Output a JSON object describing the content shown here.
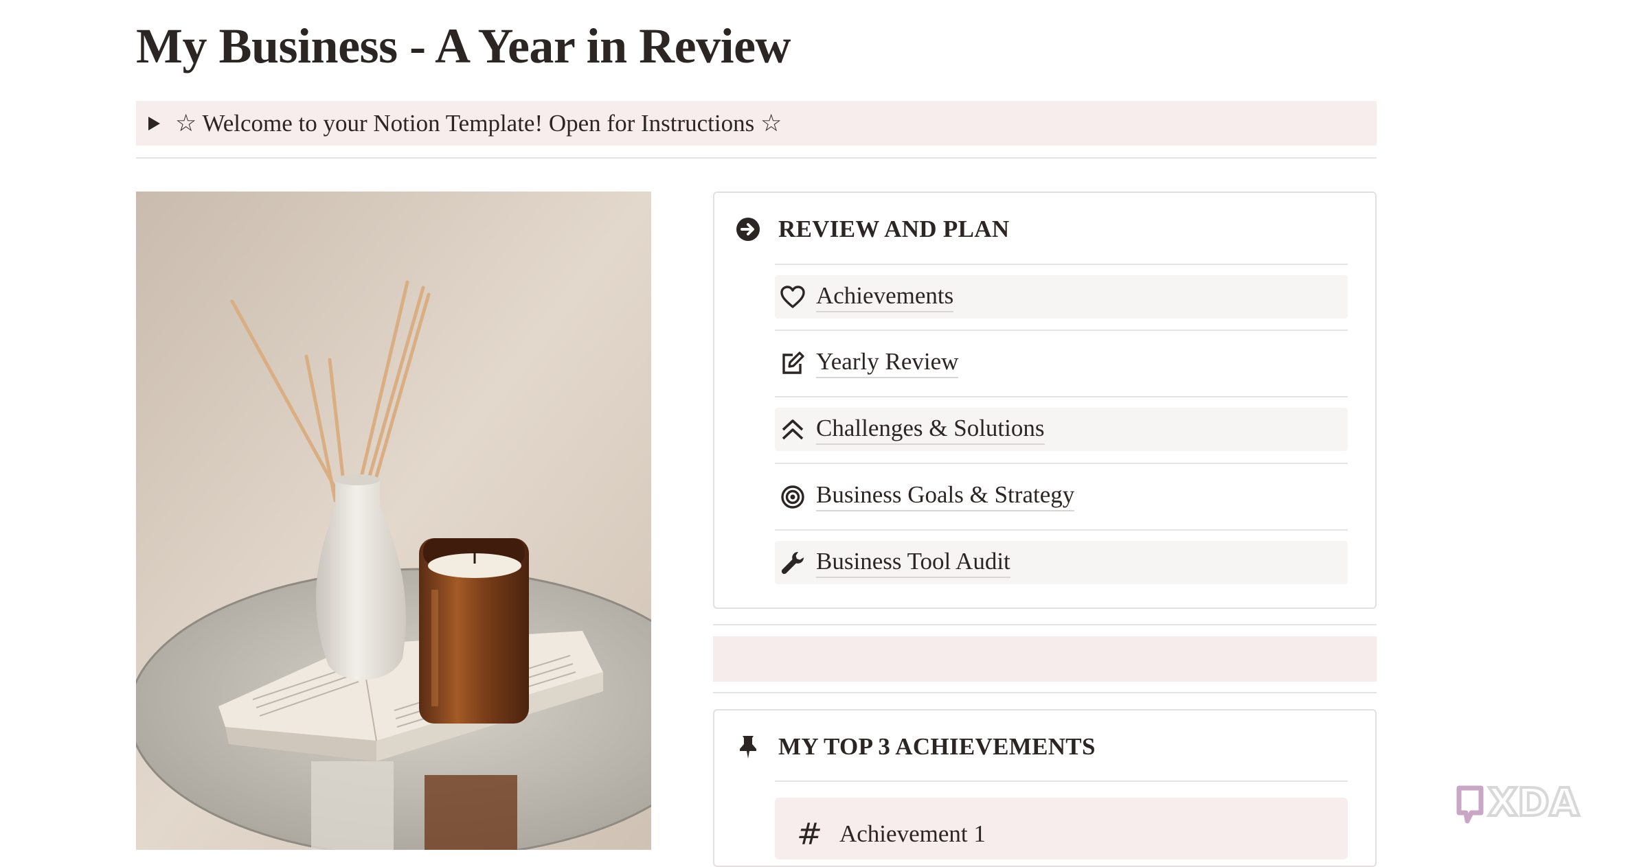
{
  "page": {
    "title": "My Business - A Year in Review"
  },
  "welcome": {
    "text": "☆ Welcome to your Notion Template! Open for Instructions ☆"
  },
  "review_plan": {
    "heading": "REVIEW AND PLAN",
    "heading_icon": "arrow-circle-right-icon",
    "items": [
      {
        "label": "Achievements",
        "icon": "heart-icon"
      },
      {
        "label": "Yearly Review",
        "icon": "edit-square-icon"
      },
      {
        "label": "Challenges & Solutions",
        "icon": "double-chevron-up-icon"
      },
      {
        "label": "Business Goals & Strategy",
        "icon": "target-icon"
      },
      {
        "label": "Business Tool Audit",
        "icon": "wrench-icon"
      }
    ]
  },
  "achievements": {
    "heading": "MY TOP 3 ACHIEVEMENTS",
    "heading_icon": "pin-icon",
    "items": [
      {
        "label": "Achievement 1",
        "icon": "hash-icon"
      }
    ]
  },
  "watermark": {
    "text": "XDA"
  },
  "colors": {
    "accent_pink": "#f7eded",
    "text": "#2b2523",
    "border": "#e4e0df"
  }
}
